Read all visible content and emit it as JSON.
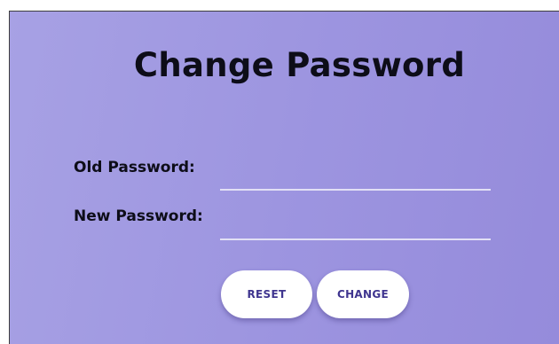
{
  "form": {
    "title": "Change Password",
    "old_password_label": "Old Password:",
    "new_password_label": "New Password:",
    "old_password_value": "",
    "new_password_value": "",
    "reset_label": "RESET",
    "change_label": "CHANGE"
  },
  "colors": {
    "background_gradient_start": "#a7a1e4",
    "background_gradient_end": "#958bdb",
    "button_text": "#3f358f",
    "input_underline": "#e2e0f5"
  }
}
